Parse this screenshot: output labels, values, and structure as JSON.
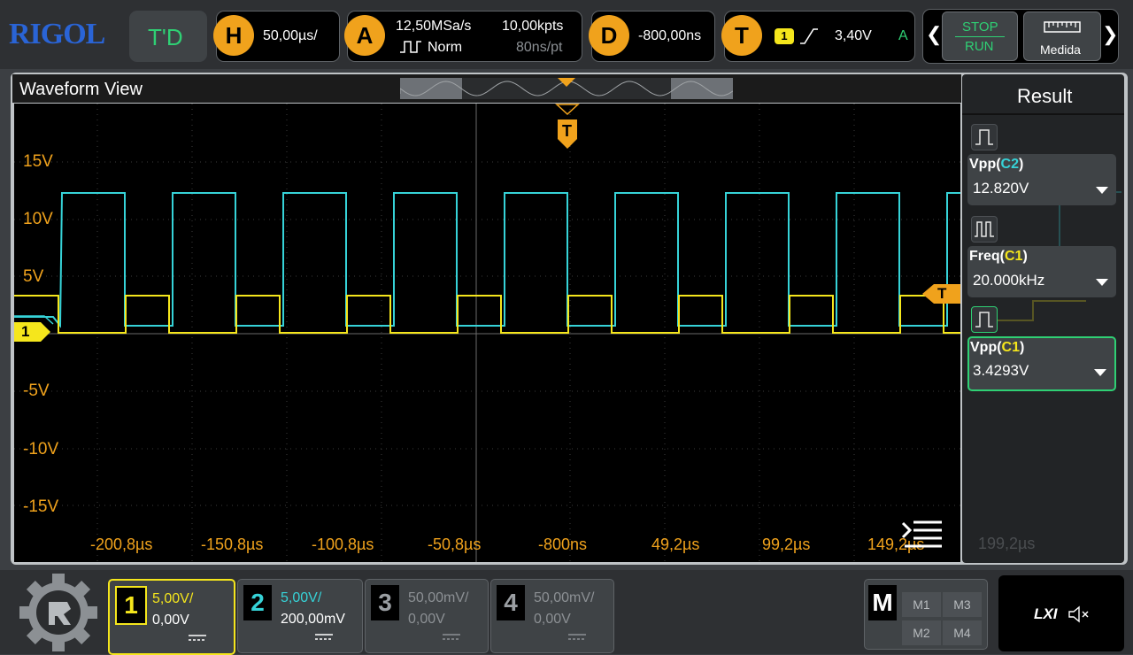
{
  "brand": "RIGOL",
  "top": {
    "td_label": "T'D",
    "h_label": "H",
    "timebase": "50,00µs/",
    "a_label": "A",
    "sample_rate": "12,50MSa/s",
    "acq_mode": "Norm",
    "mem_depth": "10,00kpts",
    "point_time": "80ns/pt",
    "d_label": "D",
    "delay": "-800,00ns",
    "t_label": "T",
    "trig_source": "1",
    "trig_level": "3,40V",
    "trig_mode": "A",
    "stop_label": "STOP",
    "run_label": "RUN",
    "measure_label": "Medida"
  },
  "waveform": {
    "title": "Waveform View",
    "trigger_marker": "T",
    "ch1_marker": "1",
    "trig_level_marker": "T",
    "y_labels": [
      "15V",
      "10V",
      "5V",
      "-5V",
      "-10V",
      "-15V"
    ],
    "x_labels": [
      "-200,8µs",
      "-150,8µs",
      "-100,8µs",
      "-50,8µs",
      "-800ns",
      "49,2µs",
      "99,2µs",
      "149,2µs",
      "199,2µs"
    ]
  },
  "result": {
    "title": "Result",
    "items": [
      {
        "name": "Vpp",
        "ch": "C2",
        "value": "12.820V",
        "color": "#36d3d8"
      },
      {
        "name": "Freq",
        "ch": "C1",
        "value": "20.000kHz",
        "color": "#f5e61c"
      },
      {
        "name": "Vpp",
        "ch": "C1",
        "value": "3.4293V",
        "color": "#f5e61c"
      }
    ]
  },
  "channels": [
    {
      "num": "1",
      "scale": "5,00V/",
      "offset": "0,00V",
      "color": "#f5e61c"
    },
    {
      "num": "2",
      "scale": "5,00V/",
      "offset": "200,00mV",
      "color": "#36d3d8"
    },
    {
      "num": "3",
      "scale": "50,00mV/",
      "offset": "0,00V",
      "color": "#9a9ea2"
    },
    {
      "num": "4",
      "scale": "50,00mV/",
      "offset": "0,00V",
      "color": "#9a9ea2"
    }
  ],
  "math": {
    "label": "M",
    "m1": "M1",
    "m2": "M2",
    "m3": "M3",
    "m4": "M4"
  },
  "lxi": "LXI",
  "colors": {
    "ch1": "#f5e61c",
    "ch2": "#36d3d8",
    "accent": "#f0a21c",
    "run": "#2fd074"
  }
}
